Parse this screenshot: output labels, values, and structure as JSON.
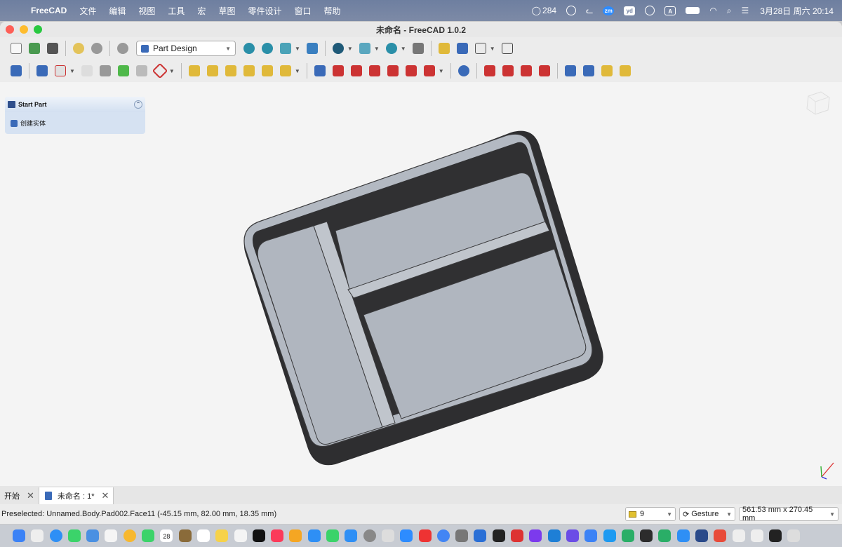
{
  "menubar": {
    "app": "FreeCAD",
    "items": [
      "文件",
      "编辑",
      "视图",
      "工具",
      "宏",
      "草图",
      "零件设计",
      "窗口",
      "帮助"
    ],
    "notif_count": "284",
    "zoom_label": "zm",
    "yd_label": "yd",
    "input_label": "A",
    "clock": "3月28日 周六  20:14"
  },
  "window": {
    "title": "未命名 - FreeCAD 1.0.2"
  },
  "toolbar": {
    "workbench": "Part Design"
  },
  "task_panel": {
    "header": "Start Part",
    "action": "创建实体"
  },
  "tabs": [
    {
      "label": "开始"
    },
    {
      "label": "未命名 : 1*"
    }
  ],
  "status": {
    "message": "Preselected: Unnamed.Body.Pad002.Face11 (-45.15 mm, 82.00 mm, 18.35 mm)",
    "draw_style": "9",
    "navigation": "Gesture",
    "dimensions": "561.53 mm x 270.45 mm"
  },
  "dock": {
    "calendar_day": "28"
  },
  "colors": {
    "part_face": "#b0b6bf",
    "part_wall": "#2e2e30",
    "accent": "#3a6ab8"
  }
}
